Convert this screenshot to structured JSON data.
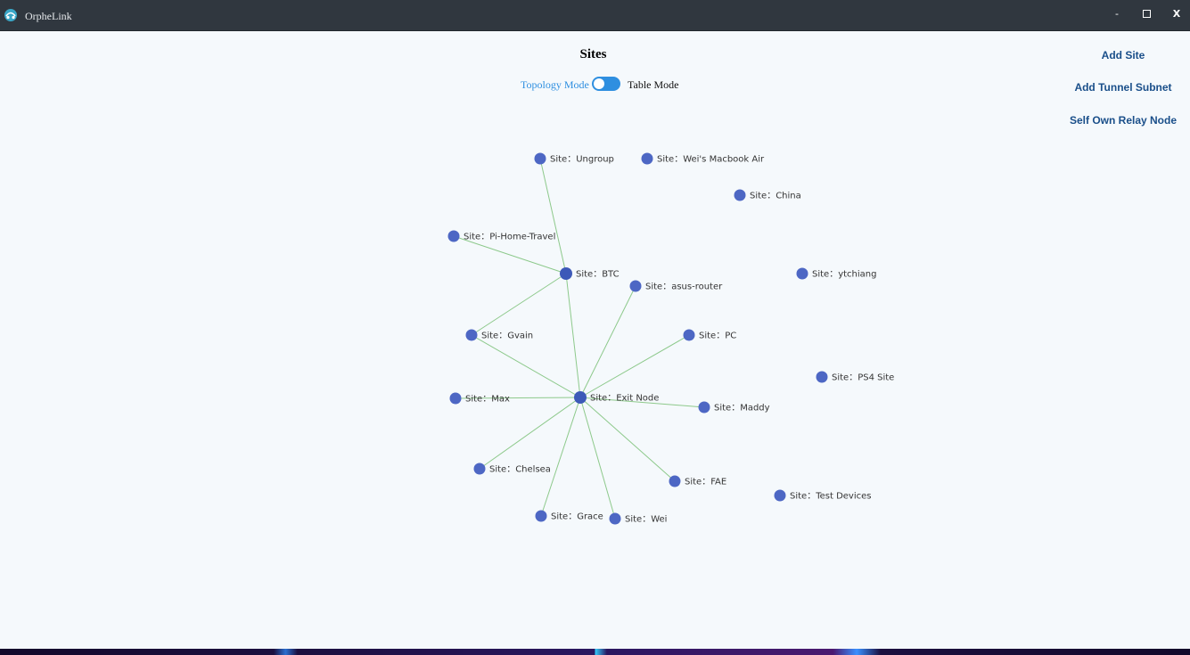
{
  "window": {
    "title": "OrpheLink",
    "minimize_label": "-",
    "close_label": "X"
  },
  "header": {
    "title": "Sites",
    "mode_left": "Topology Mode",
    "mode_right": "Table Mode"
  },
  "actions": {
    "add_site": "Add Site",
    "add_tunnel_subnet": "Add Tunnel Subnet",
    "self_own_relay_node": "Self Own Relay Node"
  },
  "colors": {
    "titlebar": "#30373f",
    "accent": "#2f8fe0",
    "node": "#4d67c4",
    "edge": "#8dc98b",
    "action_text": "#1a4f8a"
  },
  "icons": {
    "app": "orphelink-logo-icon",
    "maximize": "maximize-icon"
  },
  "topology": {
    "nodes": [
      {
        "id": "ungroup",
        "label": "Site：Ungroup"
      },
      {
        "id": "macbook",
        "label": "Site：Wei's Macbook Air"
      },
      {
        "id": "china",
        "label": "Site：China"
      },
      {
        "id": "pihome",
        "label": "Site：Pi-Home-Travel"
      },
      {
        "id": "btc",
        "label": "Site：BTC"
      },
      {
        "id": "ytchiang",
        "label": "Site：ytchiang"
      },
      {
        "id": "asus",
        "label": "Site：asus-router"
      },
      {
        "id": "gvain",
        "label": "Site：Gvain"
      },
      {
        "id": "pc",
        "label": "Site：PC"
      },
      {
        "id": "ps4",
        "label": "Site：PS4 Site"
      },
      {
        "id": "max",
        "label": "Site：Max"
      },
      {
        "id": "exit",
        "label": "Site：Exit Node"
      },
      {
        "id": "maddy",
        "label": "Site：Maddy"
      },
      {
        "id": "chelsea",
        "label": "Site：Chelsea"
      },
      {
        "id": "fae",
        "label": "Site：FAE"
      },
      {
        "id": "test",
        "label": "Site：Test Devices"
      },
      {
        "id": "grace",
        "label": "Site：Grace"
      },
      {
        "id": "wei",
        "label": "Site：Wei"
      }
    ],
    "edges": [
      [
        "ungroup",
        "btc"
      ],
      [
        "pihome",
        "btc"
      ],
      [
        "btc",
        "gvain"
      ],
      [
        "btc",
        "exit"
      ],
      [
        "gvain",
        "exit"
      ],
      [
        "asus",
        "exit"
      ],
      [
        "pc",
        "exit"
      ],
      [
        "max",
        "exit"
      ],
      [
        "maddy",
        "exit"
      ],
      [
        "chelsea",
        "exit"
      ],
      [
        "fae",
        "exit"
      ],
      [
        "grace",
        "exit"
      ],
      [
        "wei",
        "exit"
      ]
    ]
  }
}
